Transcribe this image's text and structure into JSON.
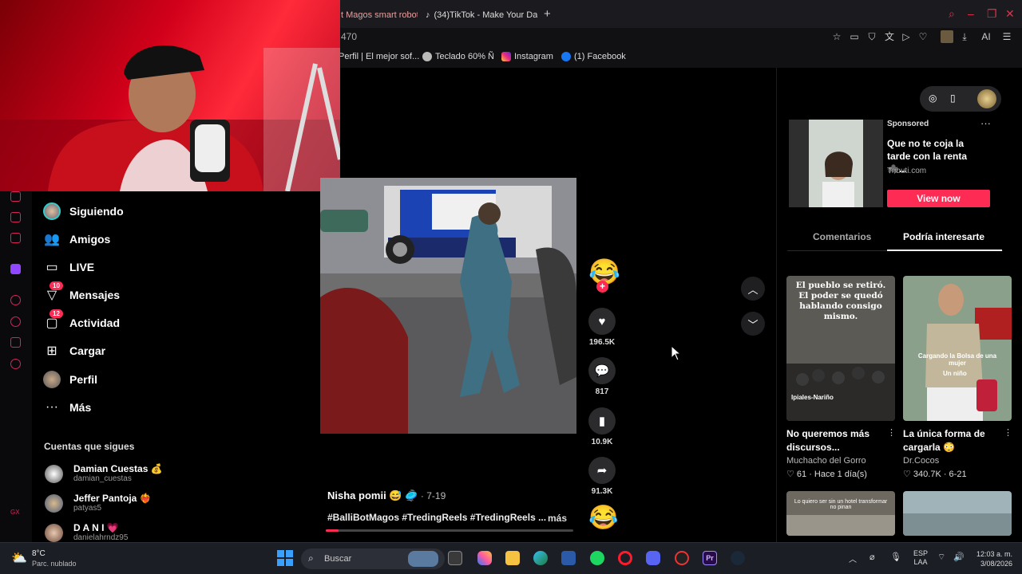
{
  "browser": {
    "tabs": [
      {
        "label": "t Magos smart robot"
      },
      {
        "icon": "tiktok-icon",
        "label": "(34)TikTok - Make Your Da"
      }
    ],
    "new_tab": "+",
    "address_partial": "470",
    "bookmarks": [
      {
        "label": "Perfil | El mejor sof...",
        "color": "#555"
      },
      {
        "label": "Teclado 60% Ñ",
        "color": "#bbbbbb"
      },
      {
        "label": "Instagram",
        "color": "#c13584"
      },
      {
        "label": "(1) Facebook",
        "color": "#1877f2"
      }
    ],
    "toolbar_ai": "AI"
  },
  "sidebar": {
    "items": [
      {
        "label": "Siguiendo",
        "icon": "following-avatar-icon"
      },
      {
        "label": "Amigos",
        "icon": "friends-icon"
      },
      {
        "label": "LIVE",
        "icon": "live-icon"
      },
      {
        "label": "Mensajes",
        "icon": "messages-icon",
        "badge": "10"
      },
      {
        "label": "Actividad",
        "icon": "activity-icon",
        "badge": "12"
      },
      {
        "label": "Cargar",
        "icon": "upload-icon"
      },
      {
        "label": "Perfil",
        "icon": "profile-avatar-icon"
      },
      {
        "label": "Más",
        "icon": "more-icon"
      }
    ],
    "follows_title": "Cuentas que sigues",
    "follows": [
      {
        "name": "Damian Cuestas 💰",
        "handle": "damian_cuestas"
      },
      {
        "name": "Jeffer Pantoja ❤‍🔥",
        "handle": "patyas5"
      },
      {
        "name": "D A N I 💗",
        "handle": "danielahrndz95"
      }
    ]
  },
  "video": {
    "author": "Nisha pomii 😅 🥏",
    "date": "· 7-19",
    "tags": "#BalliBotMagos #TredingReels #TredingReels ...",
    "more": "más",
    "progress": 0.05,
    "actions": {
      "top_emoji": "😂",
      "likes": "196.5K",
      "comments": "817",
      "saves": "10.9K",
      "shares": "91.3K",
      "bottom_emoji": "😂"
    }
  },
  "ad": {
    "sponsored": "Sponsored",
    "title": "Que no te coja la tarde con la renta 🕷️...",
    "domain": "Tributi.com",
    "cta": "View now",
    "menu": "···"
  },
  "panel_tabs": {
    "comments": "Comentarios",
    "suggested": "Podría interesarte"
  },
  "cards": [
    {
      "overlay": "El pueblo se retiró. El poder se quedó hablando consigo mismo.",
      "sub": "Ipiales-Nariño",
      "title": "No queremos más discursos...",
      "author": "Muchacho del Gorro",
      "stats": "♡ 61 · Hace 1 día(s)"
    },
    {
      "overlay": "Cargando la Bolsa de una mujer",
      "sub": "Un niño",
      "title": "La única forma de cargarla 😳",
      "author": "Dr.Cocos",
      "stats": "♡ 340.7K · 6-21"
    },
    {
      "overlay": "Lo quiero ser sin un hotel transformar no pinan",
      "title": "",
      "author": "",
      "stats": ""
    },
    {
      "overlay": "",
      "title": "",
      "author": "",
      "stats": ""
    }
  ],
  "taskbar": {
    "temp": "8°C",
    "weather": "Parc. nublado",
    "search_placeholder": "Buscar",
    "lang_top": "ESP",
    "lang_bottom": "LAA",
    "time": "12:03 a. m.",
    "date": "3/08/2026"
  }
}
